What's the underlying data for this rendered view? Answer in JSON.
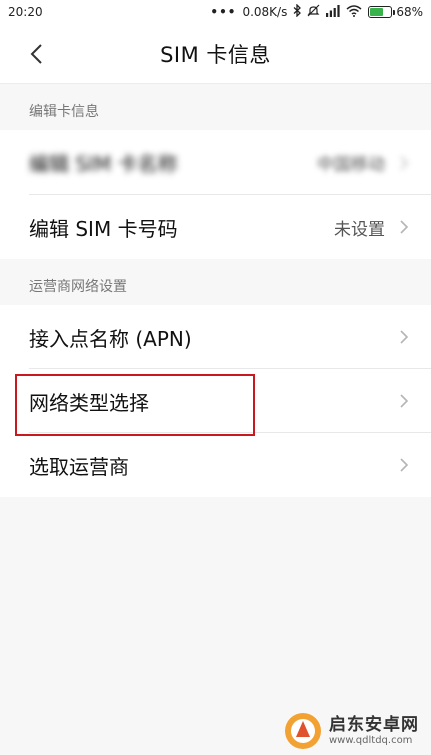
{
  "status_bar": {
    "time": "20:20",
    "dots": "•••",
    "network_speed": "0.08K/s",
    "battery_percent": "68%",
    "battery_level": 0.68,
    "icons": [
      "bluetooth-icon",
      "mute-icon",
      "signal-icon",
      "wifi-icon",
      "battery-icon"
    ]
  },
  "header": {
    "title": "SIM 卡信息",
    "back_icon": "chevron-left-icon"
  },
  "sections": [
    {
      "label": "编辑卡信息",
      "rows": [
        {
          "label": "编辑 SIM 卡名称",
          "value": "中国移动"
        },
        {
          "label": "编辑 SIM 卡号码",
          "value": "未设置"
        }
      ]
    },
    {
      "label": "运营商网络设置",
      "rows": [
        {
          "label": "接入点名称 (APN)",
          "value": ""
        },
        {
          "label": "网络类型选择",
          "value": ""
        },
        {
          "label": "选取运营商",
          "value": ""
        }
      ]
    }
  ],
  "watermark": {
    "title": "启东安卓网",
    "url": "www.qdltdq.com"
  },
  "colors": {
    "highlight": "#c9181e",
    "background": "#f7f7f7",
    "row_background": "#ffffff"
  }
}
